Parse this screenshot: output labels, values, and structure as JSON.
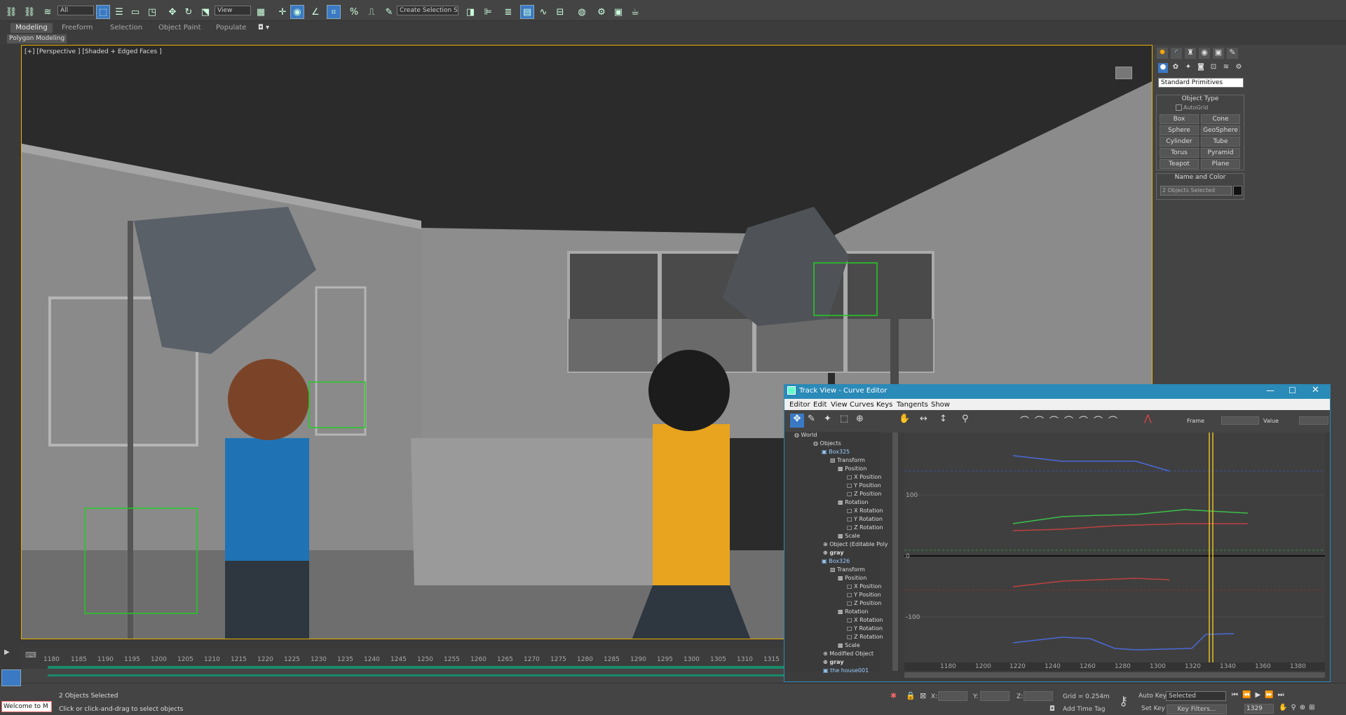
{
  "toolbar": {
    "selection_filter": "All",
    "ref_coord": "View",
    "named_sel": "Create Selection Se"
  },
  "ribbon": {
    "tabs": [
      "Modeling",
      "Freeform",
      "Selection",
      "Object Paint",
      "Populate"
    ],
    "subtitle": "Polygon Modeling"
  },
  "viewport": {
    "label": "[+] [Perspective ] [Shaded + Edged Faces ]"
  },
  "cmd": {
    "dropdown": "Standard Primitives",
    "object_type": "Object Type",
    "autogrid": "AutoGrid",
    "buttons": [
      "Box",
      "Cone",
      "Sphere",
      "GeoSphere",
      "Cylinder",
      "Tube",
      "Torus",
      "Pyramid",
      "Teapot",
      "Plane"
    ],
    "name_color": "Name and Color",
    "name_value": "2 Objects Selected"
  },
  "trackview": {
    "title": "Track View - Curve Editor",
    "menus": [
      "Editor",
      "Edit",
      "View",
      "Curves",
      "Keys",
      "Tangents",
      "Show"
    ],
    "frame_label": "Frame",
    "value_label": "Value",
    "tree": [
      "World",
      "Objects",
      "Box325",
      "Transform",
      "Position",
      "X Position",
      "Y Position",
      "Z Position",
      "Rotation",
      "X Rotation",
      "Y Rotation",
      "Z Rotation",
      "Scale",
      "Object (Editable Poly",
      "gray",
      "Box326",
      "Transform",
      "Position",
      "X Position",
      "Y Position",
      "Z Position",
      "Rotation",
      "X Rotation",
      "Y Rotation",
      "Z Rotation",
      "Scale",
      "Modified Object",
      "gray",
      "the house001"
    ],
    "y_ticks": [
      "100",
      "0",
      "-100"
    ],
    "x_ticks": [
      "1180",
      "1200",
      "1220",
      "1240",
      "1260",
      "1280",
      "1300",
      "1320",
      "1340",
      "1360",
      "1380"
    ],
    "current_frame": "1329"
  },
  "timeline": {
    "ticks": [
      "1180",
      "1185",
      "1190",
      "1195",
      "1200",
      "1205",
      "1210",
      "1215",
      "1220",
      "1225",
      "1230",
      "1235",
      "1240",
      "1245",
      "1250",
      "1255",
      "1260",
      "1265",
      "1270",
      "1275",
      "1280",
      "1285",
      "1290",
      "1295",
      "1300",
      "1305",
      "1310",
      "1315"
    ]
  },
  "status": {
    "selected": "2 Objects Selected",
    "prompt": "Click or click-and-drag to select objects",
    "welcome": "Welcome to M",
    "x": "X:",
    "y": "Y:",
    "z": "Z:",
    "grid": "Grid = 0.254m",
    "add_time_tag": "Add Time Tag",
    "auto_key": "Auto Key",
    "auto_key_value": "Selected",
    "set_key": "Set Key",
    "key_filters": "Key Filters...",
    "frame": "1329"
  }
}
